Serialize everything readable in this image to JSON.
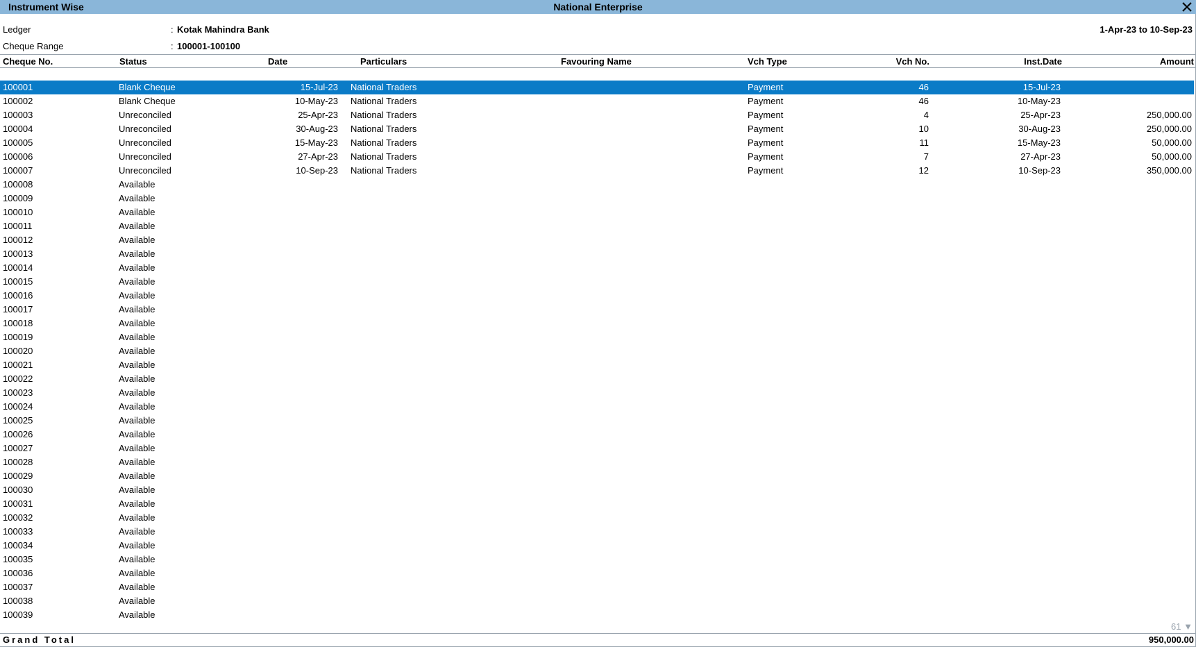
{
  "window": {
    "screen_name": "Instrument Wise",
    "company": "National Enterprise"
  },
  "info": {
    "ledger_label": "Ledger",
    "ledger_value": "Kotak Mahindra Bank",
    "range_label": "Cheque Range",
    "range_value": "100001-100100",
    "colon": ":",
    "period": "1-Apr-23 to 10-Sep-23"
  },
  "columns": {
    "cheque_no": "Cheque No.",
    "status": "Status",
    "date": "Date",
    "particulars": "Particulars",
    "favouring_name": "Favouring Name",
    "vch_type": "Vch Type",
    "vch_no": "Vch No.",
    "inst_date": "Inst.Date",
    "amount": "Amount"
  },
  "rows": [
    {
      "cheque_no": "100001",
      "status": "Blank Cheque",
      "date": "15-Jul-23",
      "particulars": "National Traders",
      "vch_type": "Payment",
      "vch_no": "46",
      "inst_date": "15-Jul-23",
      "amount": ""
    },
    {
      "cheque_no": "100002",
      "status": "Blank Cheque",
      "date": "10-May-23",
      "particulars": "National Traders",
      "vch_type": "Payment",
      "vch_no": "46",
      "inst_date": "10-May-23",
      "amount": ""
    },
    {
      "cheque_no": "100003",
      "status": "Unreconciled",
      "date": "25-Apr-23",
      "particulars": "National Traders",
      "vch_type": "Payment",
      "vch_no": "4",
      "inst_date": "25-Apr-23",
      "amount": "250,000.00"
    },
    {
      "cheque_no": "100004",
      "status": "Unreconciled",
      "date": "30-Aug-23",
      "particulars": "National Traders",
      "vch_type": "Payment",
      "vch_no": "10",
      "inst_date": "30-Aug-23",
      "amount": "250,000.00"
    },
    {
      "cheque_no": "100005",
      "status": "Unreconciled",
      "date": "15-May-23",
      "particulars": "National Traders",
      "vch_type": "Payment",
      "vch_no": "11",
      "inst_date": "15-May-23",
      "amount": "50,000.00"
    },
    {
      "cheque_no": "100006",
      "status": "Unreconciled",
      "date": "27-Apr-23",
      "particulars": "National Traders",
      "vch_type": "Payment",
      "vch_no": "7",
      "inst_date": "27-Apr-23",
      "amount": "50,000.00"
    },
    {
      "cheque_no": "100007",
      "status": "Unreconciled",
      "date": "10-Sep-23",
      "particulars": "National Traders",
      "vch_type": "Payment",
      "vch_no": "12",
      "inst_date": "10-Sep-23",
      "amount": "350,000.00"
    },
    {
      "cheque_no": "100008",
      "status": "Available"
    },
    {
      "cheque_no": "100009",
      "status": "Available"
    },
    {
      "cheque_no": "100010",
      "status": "Available"
    },
    {
      "cheque_no": "100011",
      "status": "Available"
    },
    {
      "cheque_no": "100012",
      "status": "Available"
    },
    {
      "cheque_no": "100013",
      "status": "Available"
    },
    {
      "cheque_no": "100014",
      "status": "Available"
    },
    {
      "cheque_no": "100015",
      "status": "Available"
    },
    {
      "cheque_no": "100016",
      "status": "Available"
    },
    {
      "cheque_no": "100017",
      "status": "Available"
    },
    {
      "cheque_no": "100018",
      "status": "Available"
    },
    {
      "cheque_no": "100019",
      "status": "Available"
    },
    {
      "cheque_no": "100020",
      "status": "Available"
    },
    {
      "cheque_no": "100021",
      "status": "Available"
    },
    {
      "cheque_no": "100022",
      "status": "Available"
    },
    {
      "cheque_no": "100023",
      "status": "Available"
    },
    {
      "cheque_no": "100024",
      "status": "Available"
    },
    {
      "cheque_no": "100025",
      "status": "Available"
    },
    {
      "cheque_no": "100026",
      "status": "Available"
    },
    {
      "cheque_no": "100027",
      "status": "Available"
    },
    {
      "cheque_no": "100028",
      "status": "Available"
    },
    {
      "cheque_no": "100029",
      "status": "Available"
    },
    {
      "cheque_no": "100030",
      "status": "Available"
    },
    {
      "cheque_no": "100031",
      "status": "Available"
    },
    {
      "cheque_no": "100032",
      "status": "Available"
    },
    {
      "cheque_no": "100033",
      "status": "Available"
    },
    {
      "cheque_no": "100034",
      "status": "Available"
    },
    {
      "cheque_no": "100035",
      "status": "Available"
    },
    {
      "cheque_no": "100036",
      "status": "Available"
    },
    {
      "cheque_no": "100037",
      "status": "Available"
    },
    {
      "cheque_no": "100038",
      "status": "Available"
    },
    {
      "cheque_no": "100039",
      "status": "Available"
    }
  ],
  "selected_index": 0,
  "footer": {
    "remaining_count": "61",
    "scroll_glyph": "▼",
    "grand_total_label": "Grand Total",
    "grand_total_amount": "950,000.00"
  },
  "colors": {
    "titlebar": "#8ab6d9",
    "selection": "#0a7bc7"
  },
  "icons": {
    "close": "close-icon",
    "scroll_down": "scroll-down-icon"
  }
}
